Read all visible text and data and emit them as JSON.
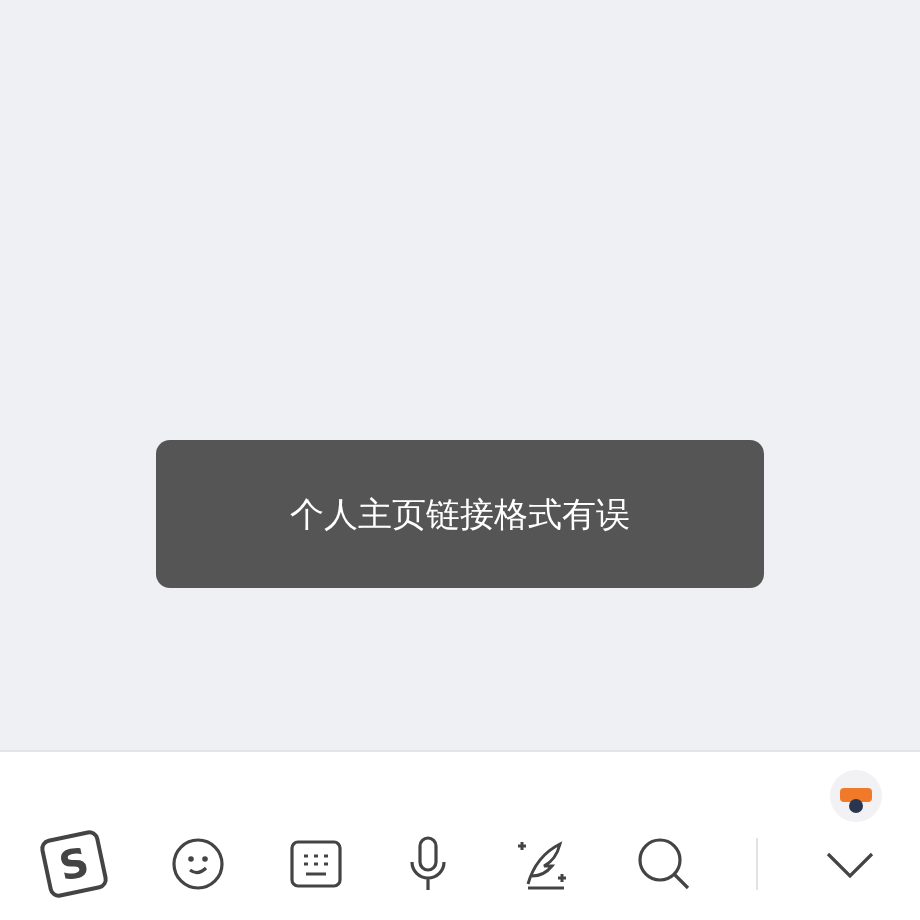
{
  "toast": {
    "message": "个人主页链接格式有误"
  },
  "keyboard_toolbar": {
    "logo_letter": "S"
  }
}
